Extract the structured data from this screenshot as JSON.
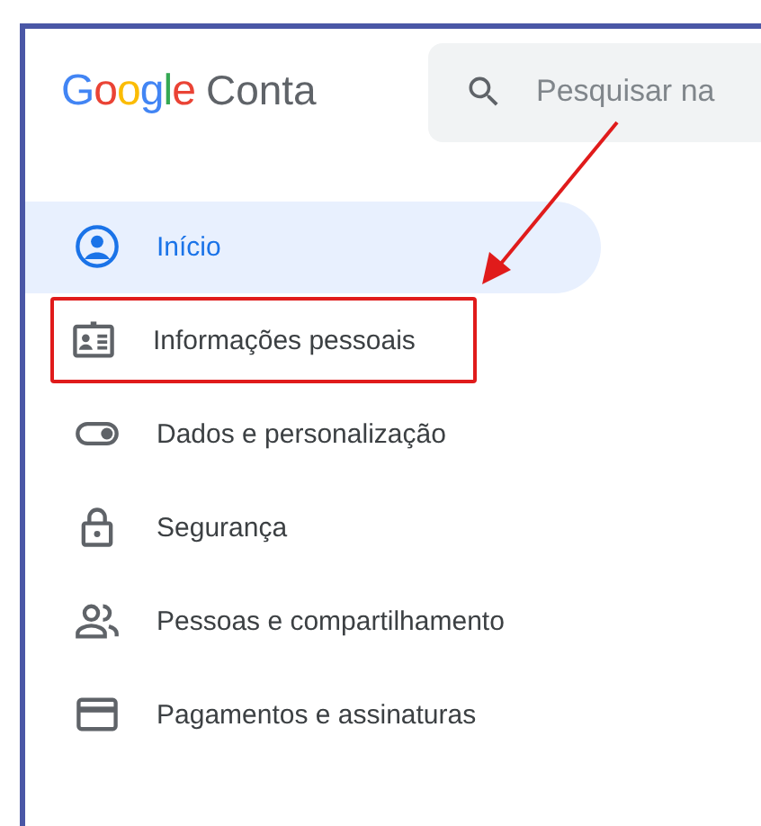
{
  "header": {
    "logo": "Google",
    "product": "Conta",
    "search": {
      "placeholder": "Pesquisar na"
    }
  },
  "nav": [
    {
      "label": "Início",
      "selected": true,
      "annotated": false
    },
    {
      "label": "Informações pessoais",
      "selected": false,
      "annotated": true
    },
    {
      "label": "Dados e personalização",
      "selected": false,
      "annotated": false
    },
    {
      "label": "Segurança",
      "selected": false,
      "annotated": false
    },
    {
      "label": "Pessoas e compartilhamento",
      "selected": false,
      "annotated": false
    },
    {
      "label": "Pagamentos e assinaturas",
      "selected": false,
      "annotated": false
    }
  ]
}
